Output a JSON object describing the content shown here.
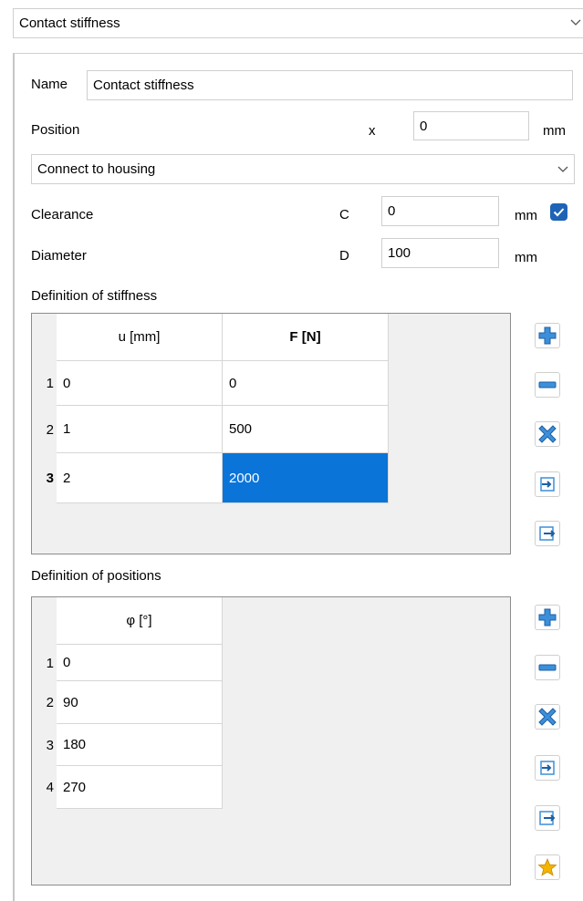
{
  "top_combo": {
    "value": "Contact stiffness"
  },
  "form": {
    "name_label": "Name",
    "name_value": "Contact stiffness",
    "position_label": "Position",
    "position_symbol": "x",
    "position_value": "0",
    "position_unit": "mm",
    "connect_combo": "Connect to housing",
    "clearance_label": "Clearance",
    "clearance_symbol": "C",
    "clearance_value": "0",
    "clearance_unit": "mm",
    "clearance_checked": true,
    "diameter_label": "Diameter",
    "diameter_symbol": "D",
    "diameter_value": "100",
    "diameter_unit": "mm"
  },
  "stiffness": {
    "title": "Definition of stiffness",
    "headers": [
      "u [mm]",
      "F [N]"
    ],
    "rows": [
      {
        "num": "1",
        "u": "0",
        "f": "0"
      },
      {
        "num": "2",
        "u": "1",
        "f": "500"
      },
      {
        "num": "3",
        "u": "2",
        "f": "2000"
      }
    ],
    "selected_row": 3
  },
  "positions": {
    "title": "Definition of positions",
    "headers": [
      "φ [°]"
    ],
    "rows": [
      {
        "num": "1",
        "phi": "0"
      },
      {
        "num": "2",
        "phi": "90"
      },
      {
        "num": "3",
        "phi": "180"
      },
      {
        "num": "4",
        "phi": "270"
      }
    ]
  },
  "icons": {
    "add": "plus-icon",
    "remove": "minus-icon",
    "clear": "x-icon",
    "import": "import-icon",
    "export": "export-icon",
    "favorite": "star-icon"
  },
  "colors": {
    "selection": "#0a74d9",
    "icon_blue": "#3d8fd9",
    "checkbox": "#1f63b6",
    "star": "#f4b400"
  }
}
